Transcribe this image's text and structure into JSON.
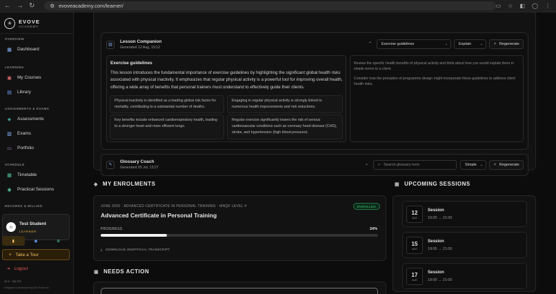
{
  "browser": {
    "url": "evoveacademy.com/learner/"
  },
  "brand": {
    "name": "EVOVE",
    "tagline": "ACADEMY"
  },
  "sidebar": {
    "sections": [
      {
        "label": "OVERVIEW",
        "items": [
          {
            "label": "Dashboard",
            "icon": "grid-icon"
          }
        ]
      },
      {
        "label": "LEARNING",
        "items": [
          {
            "label": "My Courses",
            "icon": "book-icon"
          },
          {
            "label": "Library",
            "icon": "library-icon"
          }
        ]
      },
      {
        "label": "ASSIGNMENTS & EXAMS",
        "items": [
          {
            "label": "Assessments",
            "icon": "clipboard-icon"
          },
          {
            "label": "Exams",
            "icon": "exam-icon"
          },
          {
            "label": "Portfolio",
            "icon": "folder-icon"
          }
        ]
      },
      {
        "label": "SCHEDULE",
        "items": [
          {
            "label": "Timetable",
            "icon": "calendar-icon"
          },
          {
            "label": "Practical Sessions",
            "icon": "pin-icon"
          }
        ]
      },
      {
        "label": "RECORDS & BILLING",
        "items": []
      }
    ],
    "user": {
      "name": "Test Student",
      "role": "LEARNER",
      "initials": "☺"
    },
    "tour": "Take a Tour",
    "logout": "Logout",
    "version": "v2.1 · Api 3.0",
    "credit": "Designed & Developed by Olio Pulse Inc."
  },
  "lesson_companion": {
    "title": "Lesson Companion",
    "generated": "Generated 12 Aug, 19:12",
    "topic_select": "Exercise guidelines",
    "mode_select": "Explain",
    "regenerate": "Regenerate",
    "content_title": "Exercise guidelines",
    "paragraph": "This lesson introduces the fundamental importance of exercise guidelines by highlighting the significant global health risks associated with physical inactivity. It emphasizes that regular physical activity is a powerful tool for improving overall health, offering a wide array of benefits that personal trainers must understand to effectively guide their clients.",
    "facts": [
      "Physical inactivity is identified as a leading global risk factor for mortality, contributing to a substantial number of deaths.",
      "Engaging in regular physical activity is strongly linked to numerous health improvements and risk reductions.",
      "Key benefits include enhanced cardiorespiratory health, leading to a stronger heart and more efficient lungs.",
      "Regular exercise significantly lowers the risk of serious cardiovascular conditions such as coronary heart disease (CHD), stroke, and hypertension (high blood pressure)."
    ],
    "prompts": [
      "Review the specific health benefits of physical activity and think about how you would explain them in simple terms to a client.",
      "Consider how the principles of programme design might incorporate these guidelines to address client health risks."
    ]
  },
  "glossary_coach": {
    "title": "Glossary Coach",
    "generated": "Generated 05 Jul, 13:27",
    "search_placeholder": "Search glossary term",
    "level_select": "Simple",
    "regenerate": "Regenerate"
  },
  "enrolments": {
    "heading": "MY ENROLMENTS",
    "meta": "JUNE 2026 · ADVANCED CERTIFICATE IN PERSONAL TRAINING · MNQF LEVEL 4",
    "status": "ENROLLED",
    "course": "Advanced Certificate in Personal Training",
    "progress_label": "PROGRESS",
    "progress_text": "24%",
    "progress": 0.24,
    "transcript": "DOWNLOAD UNOFFICIAL TRANSCRIPT"
  },
  "upcoming": {
    "heading": "UPCOMING SESSIONS",
    "sessions": [
      {
        "day": "12",
        "month": "AUG",
        "name": "Session",
        "time": "19:00 → 21:00"
      },
      {
        "day": "15",
        "month": "AUG",
        "name": "Session",
        "time": "19:00 → 21:00"
      },
      {
        "day": "17",
        "month": "AUG",
        "name": "Session",
        "time": "19:00 → 21:00"
      }
    ]
  },
  "needs_action": {
    "heading": "NEEDS ACTION"
  },
  "colors": {
    "accent": "#f0c064",
    "success": "#3bd27a",
    "danger": "#e0574f"
  }
}
